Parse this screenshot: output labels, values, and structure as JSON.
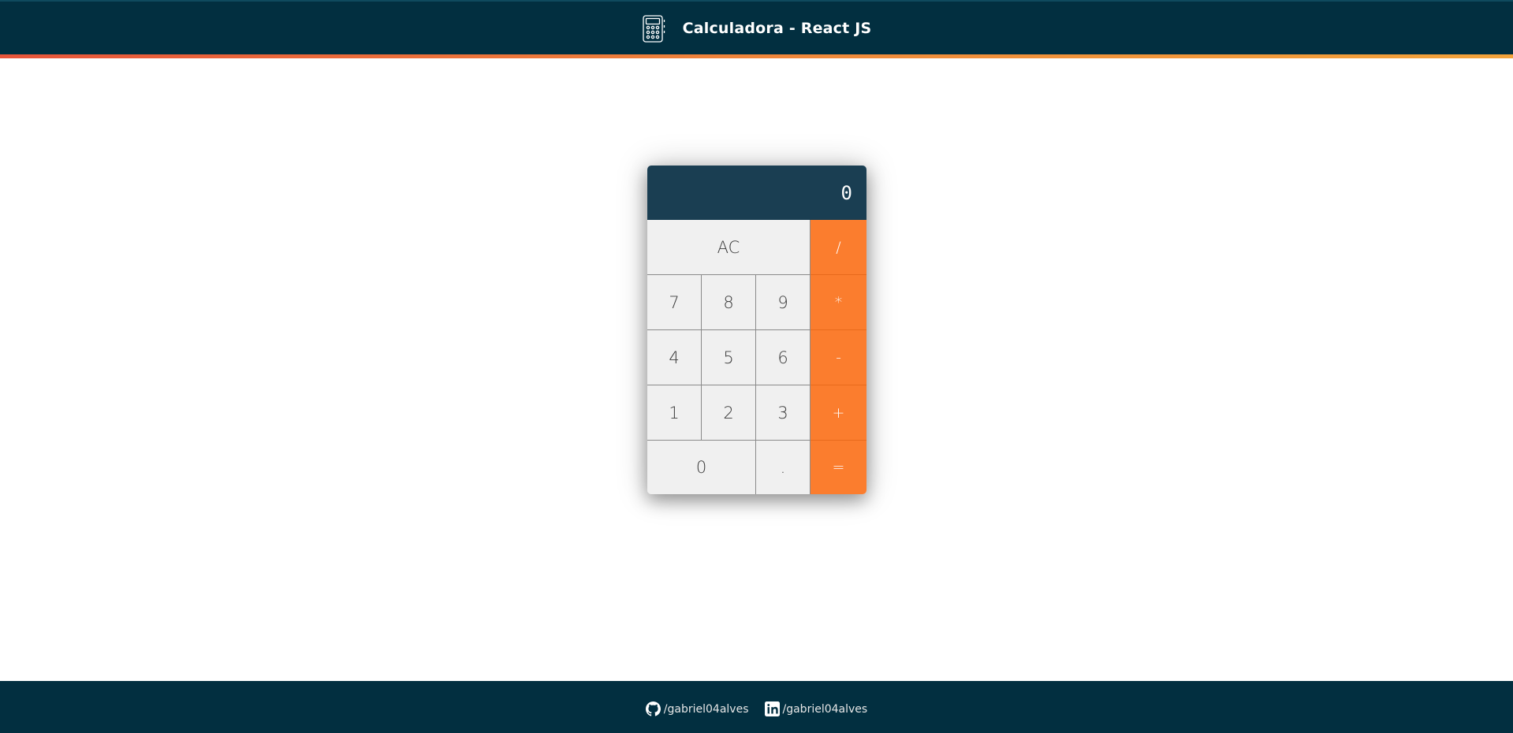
{
  "header": {
    "title": "Calculadora - React JS",
    "icon": "calculator-icon"
  },
  "calculator": {
    "display_value": "0",
    "keys": {
      "clear": "AC",
      "divide": "/",
      "seven": "7",
      "eight": "8",
      "nine": "9",
      "multiply": "*",
      "four": "4",
      "five": "5",
      "six": "6",
      "subtract": "-",
      "one": "1",
      "two": "2",
      "three": "3",
      "add": "+",
      "zero": "0",
      "decimal": ".",
      "equals": "="
    }
  },
  "footer": {
    "github": {
      "icon": "github-icon",
      "label": "/gabriel04alves"
    },
    "linkedin": {
      "icon": "linkedin-icon",
      "label": "/gabriel04alves"
    }
  },
  "colors": {
    "header_bg": "#022f40",
    "display_bg": "#1a3e52",
    "operator": "#fb7d2e",
    "key_bg": "#f0f0f0",
    "stripe_orange": "#f08a3a"
  }
}
